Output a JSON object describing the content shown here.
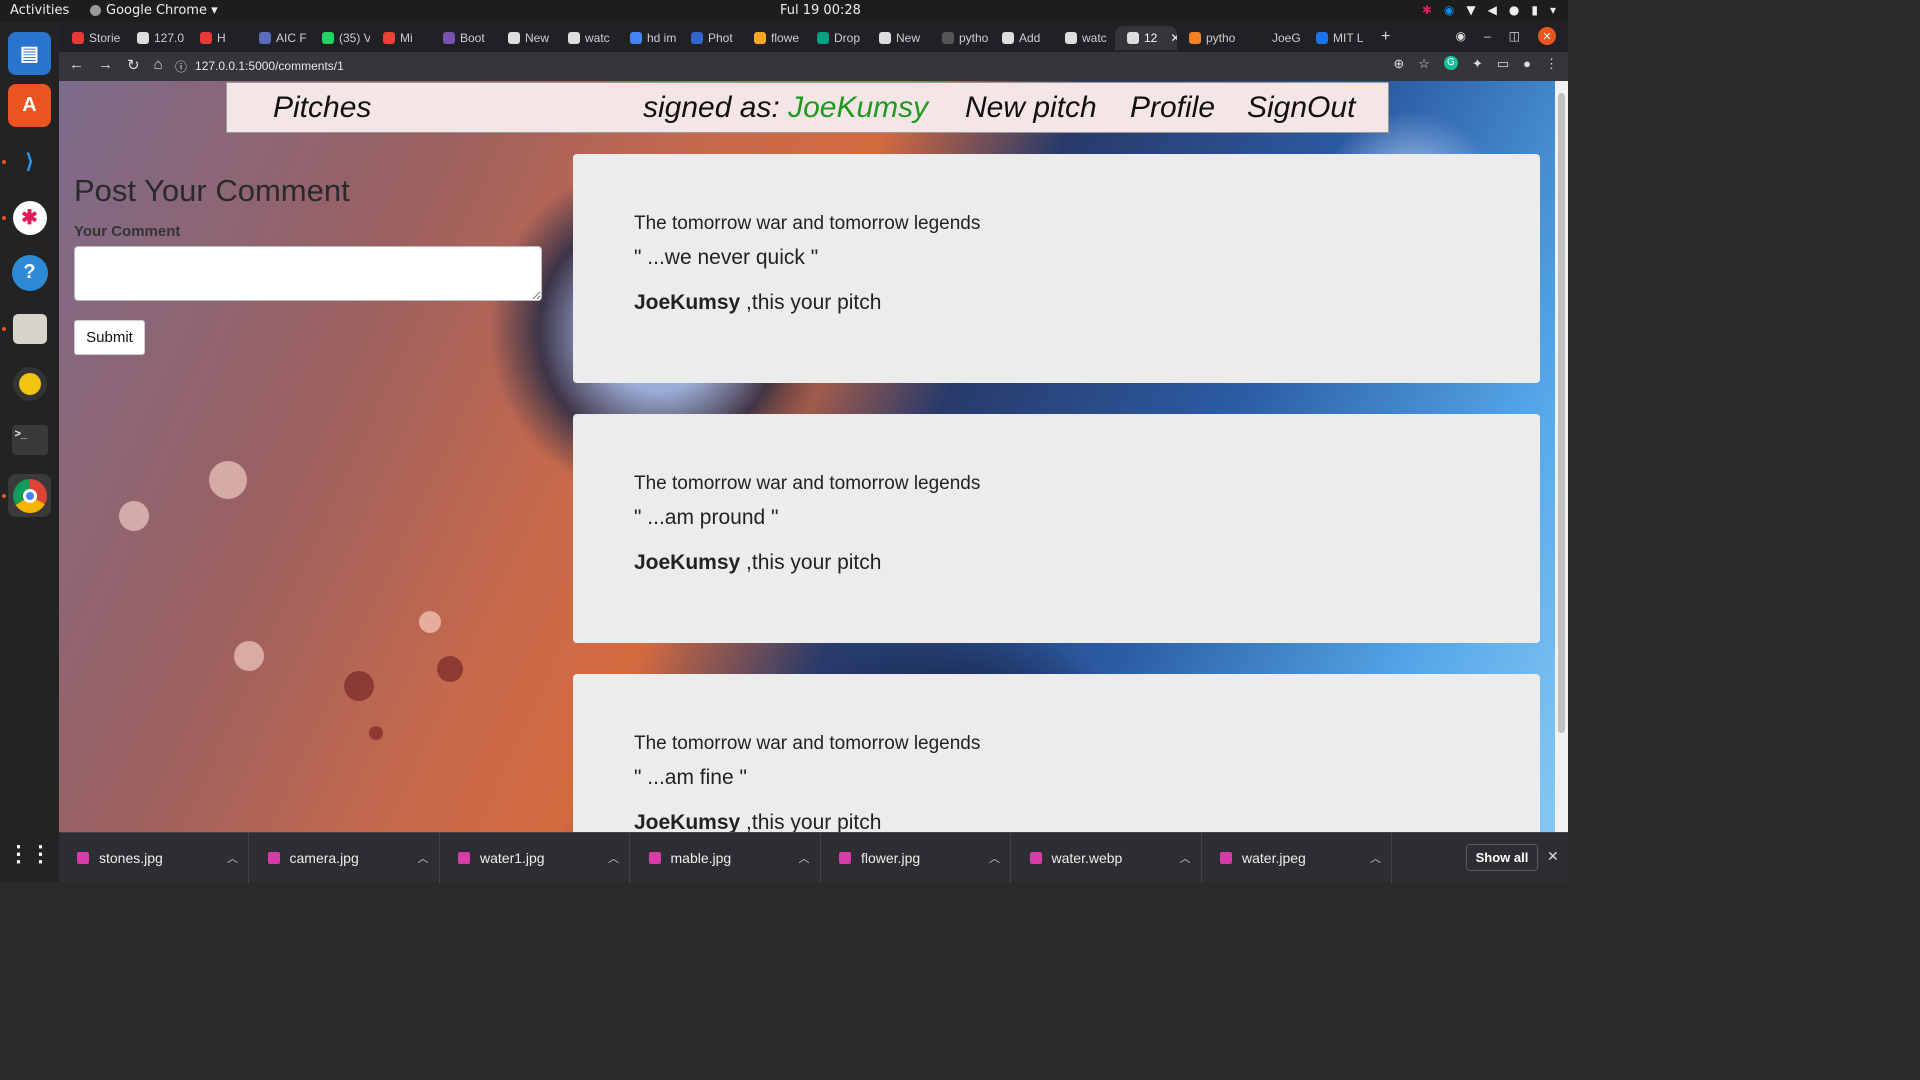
{
  "topbar": {
    "activities": "Activities",
    "app": "Google Chrome ▾",
    "clock": "Ful 19  00:28"
  },
  "tabs": [
    {
      "label": "Storie",
      "color": "#e53935"
    },
    {
      "label": "127.0",
      "color": "#dddddd"
    },
    {
      "label": "H",
      "color": "#e53935"
    },
    {
      "label": "AIC F",
      "color": "#5c6bc0"
    },
    {
      "label": "(35) V",
      "color": "#25d366"
    },
    {
      "label": "Mi",
      "color": "#ea4335"
    },
    {
      "label": "Boot",
      "color": "#7952b3"
    },
    {
      "label": "New",
      "color": "#dddddd"
    },
    {
      "label": "watc",
      "color": "#dddddd"
    },
    {
      "label": "hd im",
      "color": "#4285f4"
    },
    {
      "label": "Phot",
      "color": "#3366cc"
    },
    {
      "label": "flowe",
      "color": "#f9a825"
    },
    {
      "label": "Drop",
      "color": "#05a081"
    },
    {
      "label": "New",
      "color": "#dddddd"
    },
    {
      "label": "pytho",
      "color": "#555555"
    },
    {
      "label": "Add",
      "color": "#dddddd"
    },
    {
      "label": "watc",
      "color": "#dddddd"
    },
    {
      "label": "12",
      "color": "#dddddd",
      "active": true
    },
    {
      "label": "pytho",
      "color": "#f48024"
    },
    {
      "label": "JoeG",
      "color": "#222222"
    },
    {
      "label": "MIT L",
      "color": "#1a73e8"
    }
  ],
  "address": {
    "url": "127.0.0.1:5000/comments/1"
  },
  "site": {
    "brand": "Pitches",
    "signed_prefix": "signed as: ",
    "username": "JoeKumsy",
    "new_pitch": "New pitch",
    "profile": "Profile",
    "signout": "SignOut"
  },
  "form": {
    "heading": "Post Your Comment",
    "label": "Your Comment",
    "value": "",
    "submit": "Submit"
  },
  "pitches": [
    {
      "title": "The tomorrow war and tomorrow legends",
      "quote": "\" ...we never quick \"",
      "author": "JoeKumsy",
      "suffix": " ,this your pitch"
    },
    {
      "title": "The tomorrow war and tomorrow legends",
      "quote": "\" ...am pround \"",
      "author": "JoeKumsy",
      "suffix": " ,this your pitch"
    },
    {
      "title": "The tomorrow war and tomorrow legends",
      "quote": "\" ...am fine \"",
      "author": "JoeKumsy",
      "suffix": " ,this your pitch"
    }
  ],
  "downloads": [
    "stones.jpg",
    "camera.jpg",
    "water1.jpg",
    "mable.jpg",
    "flower.jpg",
    "water.webp",
    "water.jpeg"
  ],
  "shelf": {
    "show_all": "Show all"
  },
  "colors": {
    "username": "#1f9a1f",
    "nav_bg": "#f4e6e6",
    "card_bg": "#ececec"
  }
}
